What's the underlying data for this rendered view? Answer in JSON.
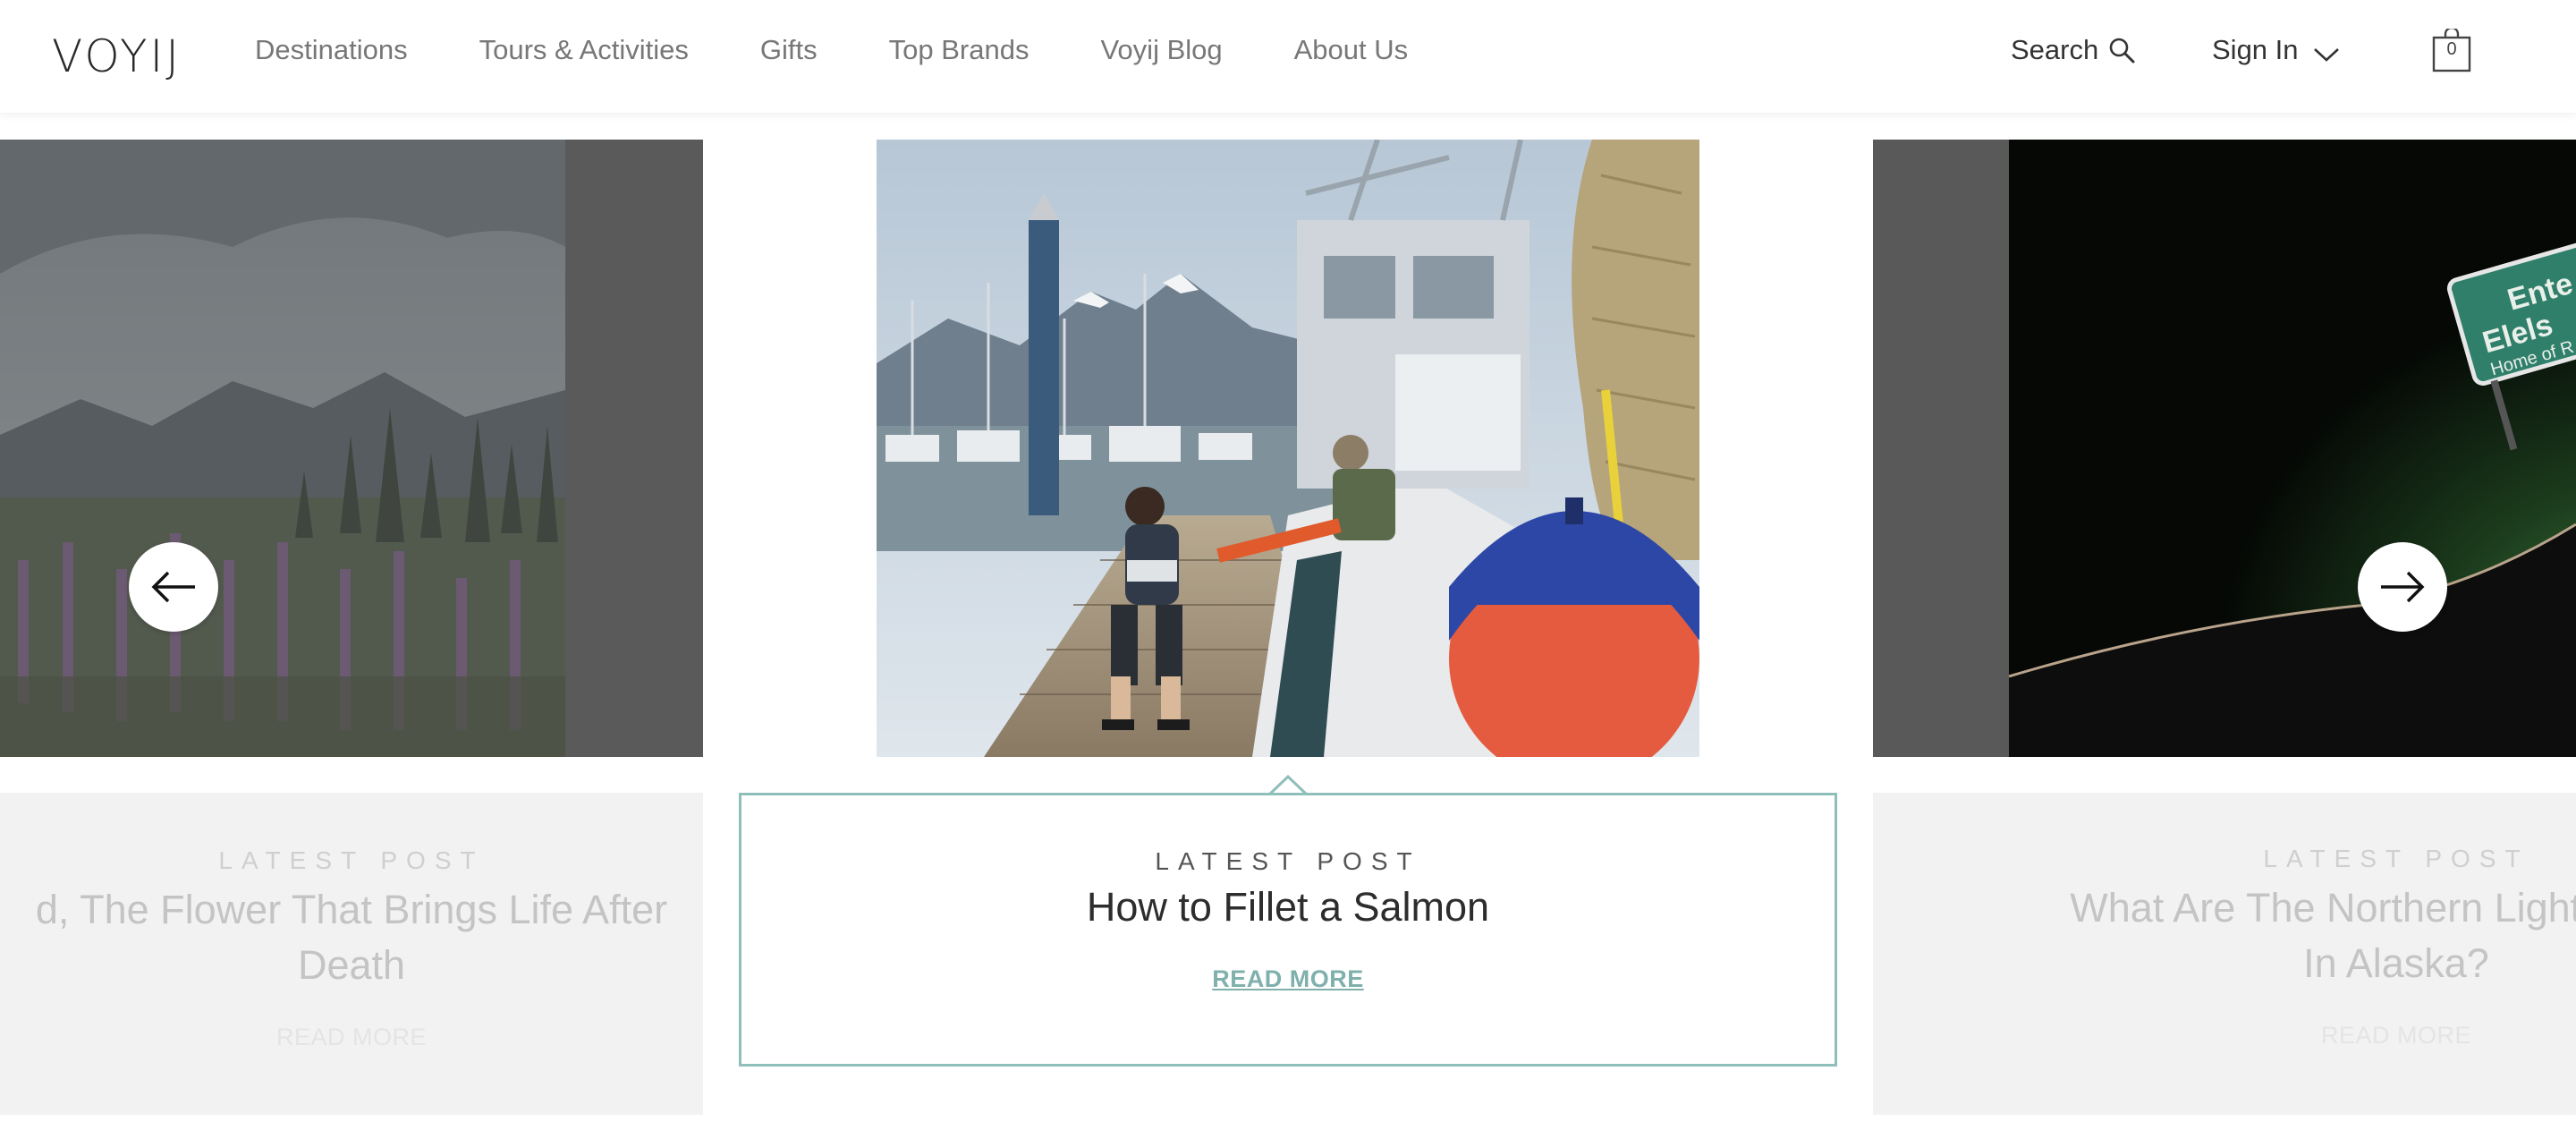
{
  "brand": {
    "logo_text": "VOYIJ"
  },
  "nav": {
    "items": [
      "Destinations",
      "Tours & Activities",
      "Gifts",
      "Top Brands",
      "Voyij Blog",
      "About Us"
    ]
  },
  "header": {
    "search_label": "Search",
    "signin_label": "Sign In",
    "cart_count": "0"
  },
  "carousel": {
    "accent_color": "#8fbfba",
    "slides": [
      {
        "eyebrow": "LATEST POST",
        "title_line1": "d, The Flower That Brings Life After",
        "title_line2": "Death",
        "read_more": "READ MORE",
        "photo_icon": "fireweed-meadow-photo"
      },
      {
        "eyebrow": "LATEST POST",
        "title": "How to Fillet a Salmon",
        "read_more": "READ MORE",
        "photo_icon": "fishing-boat-dock-photo"
      },
      {
        "eyebrow": "LATEST POST",
        "title_line1": "What Are The Northern Lights And H",
        "title_line2": "In Alaska?",
        "read_more": "READ MORE",
        "photo_icon": "northern-lights-sign-photo"
      }
    ],
    "sign_text_line1": "Ente",
    "sign_text_line2": "Elels",
    "sign_text_line3": "Home of R"
  }
}
